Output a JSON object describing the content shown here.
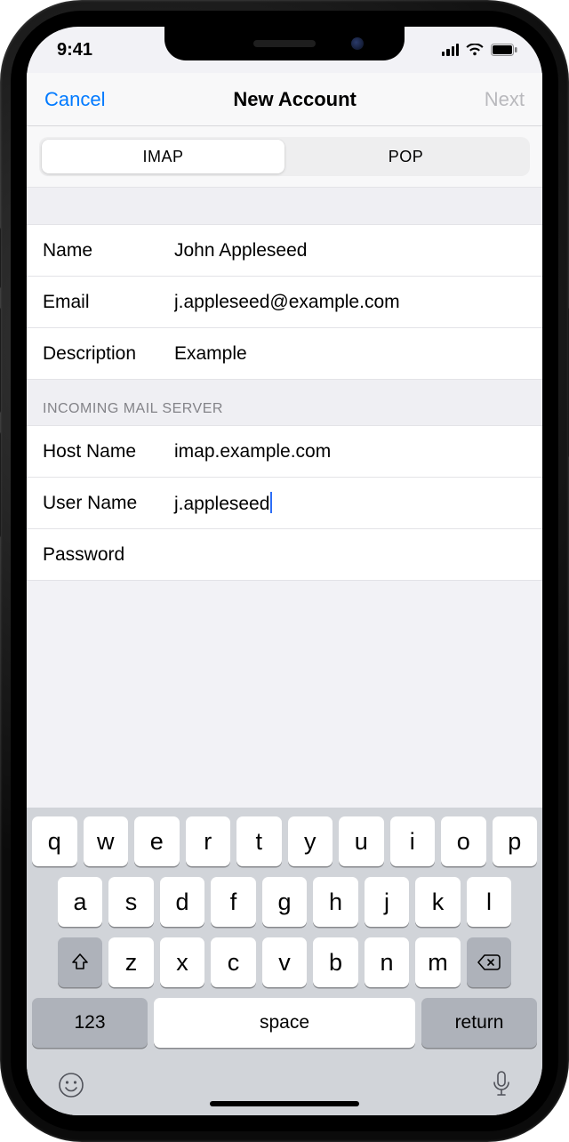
{
  "status": {
    "time": "9:41"
  },
  "nav": {
    "cancel": "Cancel",
    "title": "New Account",
    "next": "Next"
  },
  "seg": {
    "imap": "IMAP",
    "pop": "POP",
    "active": "IMAP"
  },
  "account": {
    "name_label": "Name",
    "name_value": "John Appleseed",
    "email_label": "Email",
    "email_value": "j.appleseed@example.com",
    "desc_label": "Description",
    "desc_value": "Example"
  },
  "incoming": {
    "header": "INCOMING MAIL SERVER",
    "host_label": "Host Name",
    "host_value": "imap.example.com",
    "user_label": "User Name",
    "user_value": "j.appleseed",
    "pass_label": "Password",
    "pass_value": ""
  },
  "keyboard": {
    "row1": [
      "q",
      "w",
      "e",
      "r",
      "t",
      "y",
      "u",
      "i",
      "o",
      "p"
    ],
    "row2": [
      "a",
      "s",
      "d",
      "f",
      "g",
      "h",
      "j",
      "k",
      "l"
    ],
    "row3": [
      "z",
      "x",
      "c",
      "v",
      "b",
      "n",
      "m"
    ],
    "k123": "123",
    "space": "space",
    "return": "return"
  }
}
